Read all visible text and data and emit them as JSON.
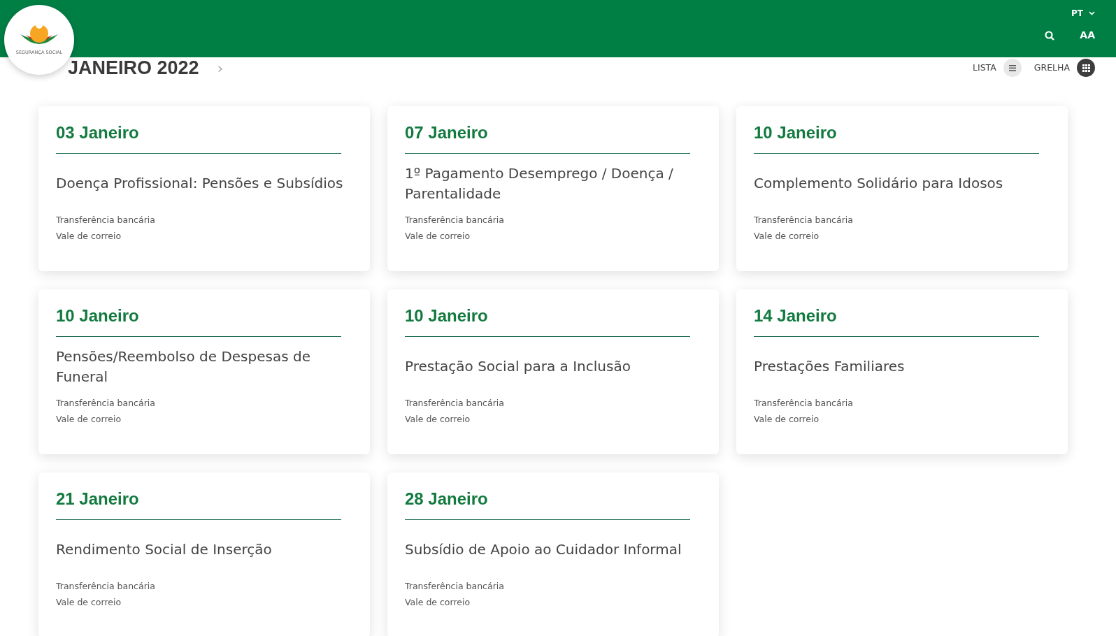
{
  "header": {
    "logo_text": "SEGURANÇA SOCIAL",
    "language": "PT",
    "font_size_button": "AA"
  },
  "month": {
    "title": "JANEIRO 2022",
    "next": "›"
  },
  "views": [
    {
      "label": "LISTA",
      "kind": "list",
      "selected": false
    },
    {
      "label": "GRELHA",
      "kind": "grid",
      "selected": true
    }
  ],
  "payments": [
    {
      "date": "03 Janeiro",
      "title": "Doença Profissional: Pensões e Subsídios",
      "methods": [
        "Transferência bancária",
        "Vale de correio"
      ]
    },
    {
      "date": "07 Janeiro",
      "title": "1º Pagamento Desemprego / Doença / Parentalidade",
      "methods": [
        "Transferência bancária",
        "Vale de correio"
      ]
    },
    {
      "date": "10 Janeiro",
      "title": "Complemento Solidário para Idosos",
      "methods": [
        "Transferência bancária",
        "Vale de correio"
      ]
    },
    {
      "date": "10 Janeiro",
      "title": "Pensões/Reembolso de Despesas de Funeral",
      "methods": [
        "Transferência bancária",
        "Vale de correio"
      ]
    },
    {
      "date": "10 Janeiro",
      "title": "Prestação Social para a Inclusão",
      "methods": [
        "Transferência bancária",
        "Vale de correio"
      ]
    },
    {
      "date": "14 Janeiro",
      "title": "Prestações Familiares",
      "methods": [
        "Transferência bancária",
        "Vale de correio"
      ]
    },
    {
      "date": "21 Janeiro",
      "title": "Rendimento Social de Inserção",
      "methods": [
        "Transferência bancária",
        "Vale de correio"
      ]
    },
    {
      "date": "28 Janeiro",
      "title": "Subsídio de Apoio ao Cuidador Informal",
      "methods": [
        "Transferência bancária",
        "Vale de correio"
      ]
    }
  ]
}
